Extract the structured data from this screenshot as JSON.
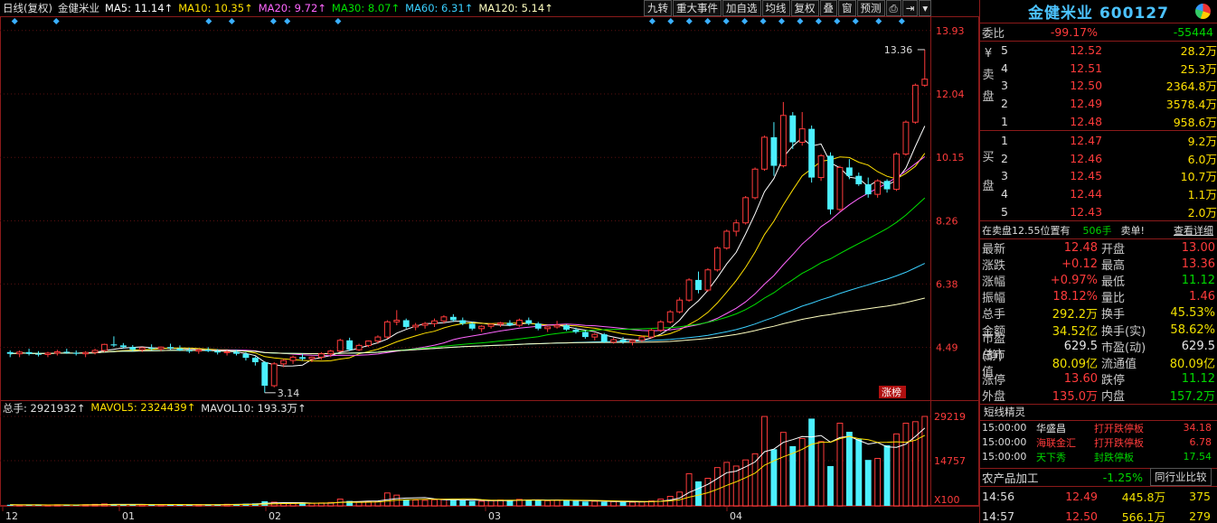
{
  "header": {
    "mode": "日线(复权)",
    "stock": "金健米业",
    "ma": [
      {
        "label": "MA5: 11.14↑",
        "color": "#ffffff"
      },
      {
        "label": "MA10: 10.35↑",
        "color": "#ffe000"
      },
      {
        "label": "MA20: 9.72↑",
        "color": "#ff66ff"
      },
      {
        "label": "MA30: 8.07↑",
        "color": "#00e000"
      },
      {
        "label": "MA60: 6.31↑",
        "color": "#3ad0ff"
      },
      {
        "label": "MA120: 5.14↑",
        "color": "#ffffc0"
      }
    ]
  },
  "buttons": [
    "九转",
    "重大事件",
    "加自选",
    "均线",
    "复权",
    "叠",
    "窗",
    "预测",
    "lock-icon",
    "exit-icon",
    "dropdown-icon"
  ],
  "price_axis": [
    "13.93",
    "12.04",
    "10.15",
    "8.26",
    "6.38",
    "4.49"
  ],
  "annotations": {
    "high_label": "13.36",
    "low_label": "3.14",
    "tag": "涨榜"
  },
  "volume": {
    "zong": "总手: 2921932↑",
    "mavol5": "MAVOL5: 2324439↑",
    "mavol10": "MAVOL10: 193.3万↑",
    "axis": [
      "29219",
      "14757"
    ],
    "unit": "X100"
  },
  "date_axis": [
    "12",
    "01",
    "02",
    "03",
    "04"
  ],
  "chart_data": {
    "type": "candlestick",
    "ylim": [
      3.0,
      14.3
    ],
    "candles": [
      [
        4.35,
        4.4,
        4.2,
        4.3
      ],
      [
        4.3,
        4.4,
        4.2,
        4.35
      ],
      [
        4.35,
        4.45,
        4.25,
        4.3
      ],
      [
        4.3,
        4.38,
        4.22,
        4.28
      ],
      [
        4.28,
        4.36,
        4.2,
        4.32
      ],
      [
        4.32,
        4.42,
        4.25,
        4.36
      ],
      [
        4.36,
        4.45,
        4.3,
        4.33
      ],
      [
        4.33,
        4.4,
        4.25,
        4.3
      ],
      [
        4.3,
        4.38,
        4.2,
        4.34
      ],
      [
        4.34,
        4.45,
        4.28,
        4.4
      ],
      [
        4.4,
        4.6,
        4.35,
        4.58
      ],
      [
        4.58,
        4.82,
        4.5,
        4.55
      ],
      [
        4.55,
        4.62,
        4.45,
        4.5
      ],
      [
        4.5,
        4.56,
        4.38,
        4.42
      ],
      [
        4.42,
        4.5,
        4.35,
        4.48
      ],
      [
        4.48,
        4.58,
        4.4,
        4.45
      ],
      [
        4.45,
        4.52,
        4.38,
        4.5
      ],
      [
        4.5,
        4.6,
        4.42,
        4.46
      ],
      [
        4.46,
        4.55,
        4.38,
        4.4
      ],
      [
        4.4,
        4.48,
        4.32,
        4.38
      ],
      [
        4.38,
        4.45,
        4.3,
        4.42
      ],
      [
        4.42,
        4.5,
        4.35,
        4.38
      ],
      [
        4.38,
        4.44,
        4.28,
        4.34
      ],
      [
        4.34,
        4.4,
        4.25,
        4.36
      ],
      [
        4.36,
        4.42,
        4.25,
        4.3
      ],
      [
        4.3,
        4.35,
        4.1,
        4.18
      ],
      [
        4.18,
        4.22,
        3.95,
        4.05
      ],
      [
        4.05,
        4.08,
        3.14,
        3.35
      ],
      [
        3.35,
        4.05,
        3.3,
        4.0
      ],
      [
        4.0,
        4.15,
        3.9,
        4.1
      ],
      [
        4.1,
        4.25,
        4.0,
        4.2
      ],
      [
        4.2,
        4.3,
        4.1,
        4.15
      ],
      [
        4.15,
        4.22,
        4.05,
        4.2
      ],
      [
        4.2,
        4.35,
        4.12,
        4.3
      ],
      [
        4.3,
        4.42,
        4.2,
        4.38
      ],
      [
        4.38,
        4.75,
        4.35,
        4.7
      ],
      [
        4.7,
        4.78,
        4.38,
        4.42
      ],
      [
        4.42,
        4.6,
        4.38,
        4.55
      ],
      [
        4.55,
        4.7,
        4.5,
        4.68
      ],
      [
        4.68,
        4.85,
        4.6,
        4.8
      ],
      [
        4.8,
        5.3,
        4.75,
        5.25
      ],
      [
        5.25,
        5.6,
        5.15,
        5.3
      ],
      [
        5.3,
        5.35,
        5.05,
        5.1
      ],
      [
        5.1,
        5.22,
        5.0,
        5.15
      ],
      [
        5.15,
        5.25,
        5.05,
        5.2
      ],
      [
        5.2,
        5.35,
        5.1,
        5.28
      ],
      [
        5.28,
        5.45,
        5.2,
        5.4
      ],
      [
        5.4,
        5.48,
        5.25,
        5.3
      ],
      [
        5.3,
        5.38,
        5.15,
        5.2
      ],
      [
        5.2,
        5.25,
        5.0,
        5.05
      ],
      [
        5.05,
        5.15,
        4.95,
        5.12
      ],
      [
        5.12,
        5.2,
        5.05,
        5.18
      ],
      [
        5.18,
        5.25,
        5.1,
        5.22
      ],
      [
        5.22,
        5.3,
        5.12,
        5.15
      ],
      [
        5.15,
        5.35,
        5.1,
        5.3
      ],
      [
        5.3,
        5.38,
        5.15,
        5.2
      ],
      [
        5.2,
        5.25,
        5.0,
        5.05
      ],
      [
        5.05,
        5.12,
        4.95,
        5.1
      ],
      [
        5.1,
        5.28,
        5.05,
        5.15
      ],
      [
        5.15,
        5.18,
        4.98,
        5.02
      ],
      [
        5.02,
        5.08,
        4.9,
        4.95
      ],
      [
        4.95,
        5.0,
        4.75,
        4.8
      ],
      [
        4.8,
        4.92,
        4.7,
        4.88
      ],
      [
        4.88,
        4.92,
        4.62,
        4.65
      ],
      [
        4.65,
        4.78,
        4.6,
        4.72
      ],
      [
        4.72,
        4.8,
        4.6,
        4.65
      ],
      [
        4.65,
        4.72,
        4.55,
        4.7
      ],
      [
        4.7,
        4.85,
        4.65,
        4.8
      ],
      [
        4.8,
        5.05,
        4.75,
        5.0
      ],
      [
        5.0,
        5.3,
        4.95,
        5.25
      ],
      [
        5.25,
        5.6,
        5.2,
        5.55
      ],
      [
        5.55,
        5.98,
        5.5,
        5.9
      ],
      [
        5.9,
        6.55,
        5.85,
        6.5
      ],
      [
        6.5,
        6.75,
        6.1,
        6.2
      ],
      [
        6.2,
        6.85,
        6.15,
        6.8
      ],
      [
        6.8,
        7.5,
        6.75,
        7.45
      ],
      [
        7.45,
        8.0,
        7.4,
        7.95
      ],
      [
        7.95,
        8.3,
        7.8,
        8.2
      ],
      [
        8.2,
        9.0,
        8.15,
        8.95
      ],
      [
        8.95,
        9.85,
        8.9,
        9.8
      ],
      [
        9.8,
        10.8,
        9.75,
        10.75
      ],
      [
        10.75,
        11.2,
        9.6,
        9.9
      ],
      [
        9.9,
        11.8,
        9.85,
        11.4
      ],
      [
        11.4,
        11.5,
        10.4,
        10.6
      ],
      [
        10.6,
        11.5,
        10.5,
        11.0
      ],
      [
        11.0,
        11.1,
        9.4,
        9.55
      ],
      [
        9.55,
        10.25,
        9.45,
        10.2
      ],
      [
        10.2,
        10.3,
        8.45,
        8.6
      ],
      [
        8.6,
        9.9,
        8.55,
        9.85
      ],
      [
        9.85,
        10.1,
        9.5,
        9.6
      ],
      [
        9.6,
        9.7,
        9.3,
        9.35
      ],
      [
        9.35,
        9.55,
        8.95,
        9.05
      ],
      [
        9.05,
        9.5,
        8.95,
        9.45
      ],
      [
        9.45,
        9.5,
        9.1,
        9.2
      ],
      [
        9.2,
        10.3,
        9.15,
        10.25
      ],
      [
        10.25,
        11.25,
        10.2,
        11.2
      ],
      [
        11.2,
        12.35,
        11.15,
        12.3
      ],
      [
        12.3,
        13.36,
        12.25,
        12.48
      ]
    ],
    "volumes": [
      34,
      30,
      32,
      28,
      30,
      34,
      30,
      28,
      36,
      48,
      62,
      55,
      40,
      35,
      38,
      44,
      40,
      36,
      32,
      30,
      38,
      42,
      45,
      50,
      55,
      70,
      80,
      150,
      120,
      90,
      80,
      75,
      82,
      95,
      110,
      220,
      160,
      130,
      145,
      140,
      420,
      350,
      210,
      190,
      180,
      200,
      220,
      190,
      180,
      160,
      150,
      170,
      190,
      185,
      210,
      205,
      180,
      165,
      190,
      175,
      160,
      140,
      150,
      130,
      140,
      125,
      120,
      130,
      160,
      220,
      310,
      450,
      1050,
      800,
      900,
      1250,
      1420,
      1300,
      1500,
      1700,
      2920,
      1850,
      2400,
      1950,
      2200,
      2850,
      2100,
      1300,
      2700,
      2420,
      2180,
      1500,
      1550,
      1980,
      2350,
      2700,
      2750,
      2922
    ],
    "bull_color": "#ff3b3b",
    "bear_color": "#4cf0ff"
  },
  "sidebar": {
    "title": "金健米业 600127",
    "weibi_label": "委比",
    "weibi_pct": "-99.17%",
    "weibi_val": "-55444",
    "sell_label": "¥ 卖盘",
    "buy_label": "买盘",
    "sell": [
      {
        "n": "5",
        "p": "12.52",
        "v": "28.2万"
      },
      {
        "n": "4",
        "p": "12.51",
        "v": "25.3万"
      },
      {
        "n": "3",
        "p": "12.50",
        "v": "2364.8万"
      },
      {
        "n": "2",
        "p": "12.49",
        "v": "3578.4万"
      },
      {
        "n": "1",
        "p": "12.48",
        "v": "958.6万"
      }
    ],
    "buy": [
      {
        "n": "1",
        "p": "12.47",
        "v": "9.2万"
      },
      {
        "n": "2",
        "p": "12.46",
        "v": "6.0万"
      },
      {
        "n": "3",
        "p": "12.45",
        "v": "10.7万"
      },
      {
        "n": "4",
        "p": "12.44",
        "v": "1.1万"
      },
      {
        "n": "5",
        "p": "12.43",
        "v": "2.0万"
      }
    ],
    "note_prefix": "在卖盘12.55位置有",
    "note_vol": "506手",
    "note_suffix": "卖单!",
    "detail_link": "查看详细",
    "stats": [
      {
        "k1": "最新",
        "v1": "12.48",
        "c1": "red",
        "k2": "开盘",
        "v2": "13.00",
        "c2": "red"
      },
      {
        "k1": "涨跌",
        "v1": "+0.12",
        "c1": "red",
        "k2": "最高",
        "v2": "13.36",
        "c2": "red"
      },
      {
        "k1": "涨幅",
        "v1": "+0.97%",
        "c1": "red",
        "k2": "最低",
        "v2": "11.12",
        "c2": "green"
      },
      {
        "k1": "振幅",
        "v1": "18.12%",
        "c1": "red",
        "k2": "量比",
        "v2": "1.46",
        "c2": "red"
      },
      {
        "k1": "总手",
        "v1": "292.2万",
        "c1": "yellow",
        "k2": "换手",
        "v2": "45.53%",
        "c2": "yellow"
      },
      {
        "k1": "金额",
        "v1": "34.52亿",
        "c1": "yellow",
        "k2": "换手(实)",
        "v2": "58.62%",
        "c2": "yellow"
      },
      {
        "k1": "市盈(静)",
        "v1": "629.5",
        "c1": "white",
        "k2": "市盈(动)",
        "v2": "629.5",
        "c2": "white"
      },
      {
        "k1": "总市值",
        "v1": "80.09亿",
        "c1": "yellow",
        "k2": "流通值",
        "v2": "80.09亿",
        "c2": "yellow"
      },
      {
        "k1": "涨停",
        "v1": "13.60",
        "c1": "red",
        "k2": "跌停",
        "v2": "11.12",
        "c2": "green"
      },
      {
        "k1": "外盘",
        "v1": "135.0万",
        "c1": "red",
        "k2": "内盘",
        "v2": "157.2万",
        "c2": "green"
      }
    ],
    "jingling_title": "短线精灵",
    "jingling": [
      {
        "t": "15:00:00",
        "name": "华盛昌",
        "ev": "打开跌停板",
        "val": "34.18"
      },
      {
        "t": "15:00:00",
        "name": "海联金汇",
        "ev": "打开跌停板",
        "val": "6.78"
      },
      {
        "t": "15:00:00",
        "name": "天下秀",
        "ev": "封跌停板",
        "val": "17.54"
      }
    ],
    "sector": "农产品加工",
    "sector_pct": "-1.25%",
    "sector_btn": "同行业比较",
    "ticks": [
      {
        "t": "14:56",
        "p": "12.49",
        "v": "445.8万",
        "n": "375"
      },
      {
        "t": "14:57",
        "p": "12.50",
        "v": "566.1万",
        "n": "279"
      }
    ]
  }
}
